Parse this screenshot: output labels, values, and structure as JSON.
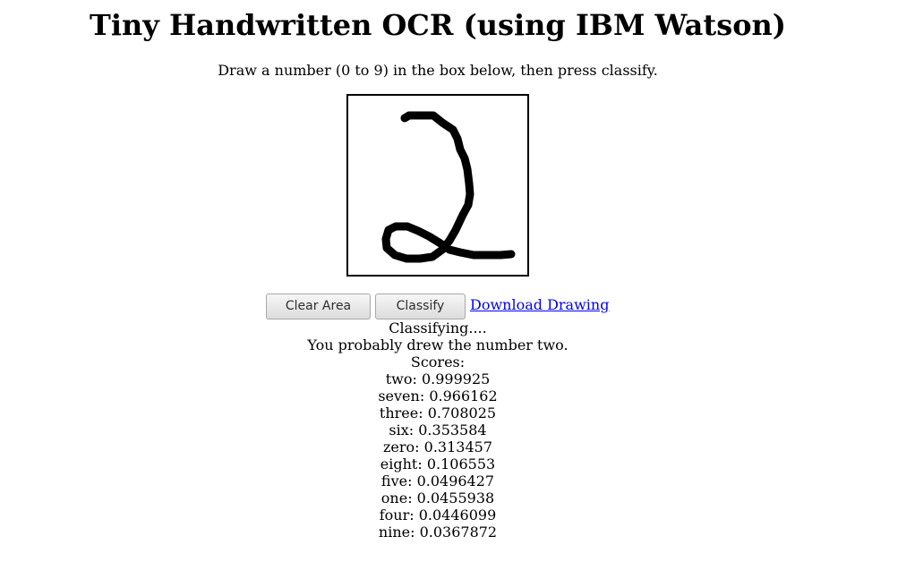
{
  "page": {
    "title": "Tiny Handwritten OCR (using IBM Watson)",
    "instructions": "Draw a number (0 to 9) in the box below, then press classify."
  },
  "controls": {
    "clear_label": "Clear Area",
    "classify_label": "Classify",
    "download_label": "Download Drawing"
  },
  "results": {
    "status": "Classifying....",
    "prediction": "You probably drew the number two.",
    "scores_heading": "Scores:",
    "scores": [
      {
        "label": "two",
        "score": "0.999925"
      },
      {
        "label": "seven",
        "score": "0.966162"
      },
      {
        "label": "three",
        "score": "0.708025"
      },
      {
        "label": "six",
        "score": "0.353584"
      },
      {
        "label": "zero",
        "score": "0.313457"
      },
      {
        "label": "eight",
        "score": "0.106553"
      },
      {
        "label": "five",
        "score": "0.0496427"
      },
      {
        "label": "one",
        "score": "0.0455938"
      },
      {
        "label": "four",
        "score": "0.0446099"
      },
      {
        "label": "nine",
        "score": "0.0367872"
      }
    ]
  },
  "colors": {
    "ink": "#000000",
    "link": "#0000ee",
    "background": "#ffffff"
  }
}
